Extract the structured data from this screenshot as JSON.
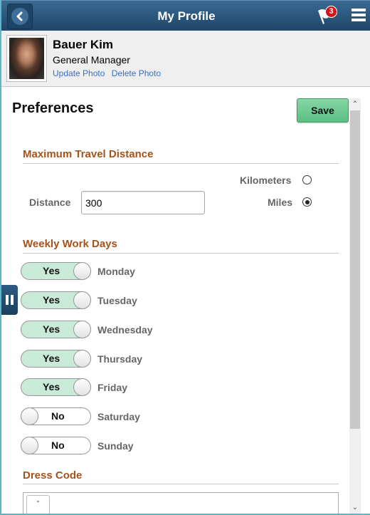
{
  "header": {
    "title": "My Profile",
    "back_icon": "chevron-left-icon",
    "notifications_icon": "flag-icon",
    "notifications_count": "3",
    "menu_icon": "hamburger-menu-icon"
  },
  "profile": {
    "name": "Bauer Kim",
    "job_title": "General Manager",
    "update_photo_label": "Update Photo",
    "delete_photo_label": "Delete Photo"
  },
  "preferences": {
    "title": "Preferences",
    "save_label": "Save",
    "travel": {
      "section_title": "Maximum Travel Distance",
      "distance_label": "Distance",
      "distance_value": "300",
      "units": [
        {
          "label": "Kilometers",
          "selected": false
        },
        {
          "label": "Miles",
          "selected": true
        }
      ]
    },
    "work_days": {
      "section_title": "Weekly Work Days",
      "days": [
        {
          "day": "Monday",
          "value": "Yes"
        },
        {
          "day": "Tuesday",
          "value": "Yes"
        },
        {
          "day": "Wednesday",
          "value": "Yes"
        },
        {
          "day": "Thursday",
          "value": "Yes"
        },
        {
          "day": "Friday",
          "value": "Yes"
        },
        {
          "day": "Saturday",
          "value": "No"
        },
        {
          "day": "Sunday",
          "value": "No"
        }
      ]
    },
    "dress_code": {
      "section_title": "Dress Code",
      "button_label": "-"
    }
  },
  "colors": {
    "header_bg": "#1e4568",
    "section_title": "#a5521b",
    "save_bg": "#5bbf85",
    "toggle_on_bg": "#c9ead8",
    "link": "#3a6fc4",
    "badge": "#d0141a"
  }
}
